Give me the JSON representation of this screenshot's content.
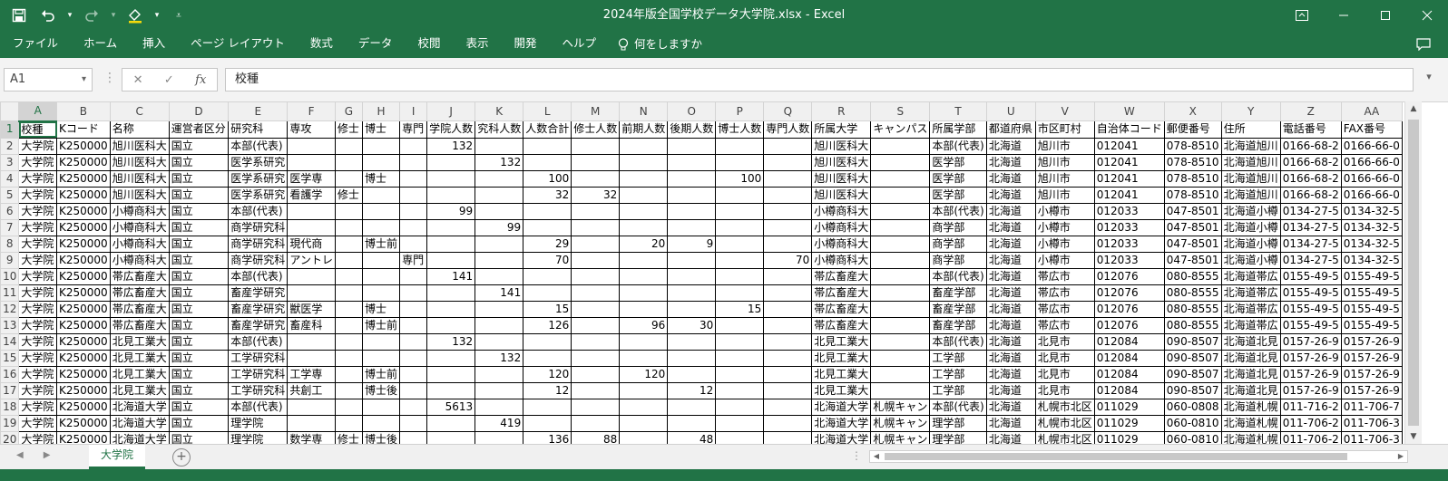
{
  "titlebar": {
    "title": "2024年版全国学校データ大学院.xlsx  -  Excel",
    "qat_icons": [
      "save-icon",
      "undo-icon",
      "redo-icon",
      "paint-brush-icon",
      "customize-qat-icon"
    ],
    "window_controls": [
      "ribbon-display-icon",
      "minimize-icon",
      "restore-icon",
      "close-icon"
    ]
  },
  "ribbon": {
    "tabs": [
      "ファイル",
      "ホーム",
      "挿入",
      "ページ レイアウト",
      "数式",
      "データ",
      "校閲",
      "表示",
      "開発",
      "ヘルプ"
    ],
    "tell_me": "何をしますか"
  },
  "formula_bar": {
    "name_box": "A1",
    "fx_label": "fx",
    "content": "校種"
  },
  "sheet": {
    "columns": [
      {
        "letter": "A",
        "w": 48
      },
      {
        "letter": "B",
        "w": 54
      },
      {
        "letter": "C",
        "w": 66
      },
      {
        "letter": "D",
        "w": 70
      },
      {
        "letter": "E",
        "w": 66
      },
      {
        "letter": "F",
        "w": 44
      },
      {
        "letter": "G",
        "w": 42
      },
      {
        "letter": "H",
        "w": 42
      },
      {
        "letter": "I",
        "w": 42
      },
      {
        "letter": "J",
        "w": 50
      },
      {
        "letter": "K",
        "w": 50
      },
      {
        "letter": "L",
        "w": 50
      },
      {
        "letter": "M",
        "w": 50
      },
      {
        "letter": "N",
        "w": 50
      },
      {
        "letter": "O",
        "w": 50
      },
      {
        "letter": "P",
        "w": 50
      },
      {
        "letter": "Q",
        "w": 50
      },
      {
        "letter": "R",
        "w": 58
      },
      {
        "letter": "S",
        "w": 62
      },
      {
        "letter": "T",
        "w": 64
      },
      {
        "letter": "U",
        "w": 64
      },
      {
        "letter": "V",
        "w": 64
      },
      {
        "letter": "W",
        "w": 76
      },
      {
        "letter": "X",
        "w": 64
      },
      {
        "letter": "Y",
        "w": 64
      },
      {
        "letter": "Z",
        "w": 64
      },
      {
        "letter": "AA",
        "w": 62
      }
    ],
    "numeric_cols": [
      9,
      10,
      11,
      12,
      13,
      14,
      15,
      16
    ],
    "rows": [
      [
        "校種",
        "Kコード",
        "名称",
        "運営者区分",
        "研究科",
        "専攻",
        "修士",
        "博士",
        "専門",
        "学院人数",
        "究科人数",
        "人数合計",
        "修士人数",
        "前期人数",
        "後期人数",
        "博士人数",
        "専門人数",
        "所属大学",
        "キャンパス",
        "所属学部",
        "都道府県",
        "市区町村",
        "自治体コード",
        "郵便番号",
        "住所",
        "電話番号",
        "FAX番号"
      ],
      [
        "大学院",
        "K250000",
        "旭川医科大",
        "国立",
        "本部(代表)",
        "",
        "",
        "",
        "",
        "132",
        "",
        "",
        "",
        "",
        "",
        "",
        "",
        "旭川医科大",
        "",
        "本部(代表)",
        "北海道",
        "旭川市",
        "012041",
        "078-8510",
        "北海道旭川",
        "0166-68-2",
        "0166-66-0"
      ],
      [
        "大学院",
        "K250000",
        "旭川医科大",
        "国立",
        "医学系研究",
        "",
        "",
        "",
        "",
        "",
        "132",
        "",
        "",
        "",
        "",
        "",
        "",
        "旭川医科大",
        "",
        "医学部",
        "北海道",
        "旭川市",
        "012041",
        "078-8510",
        "北海道旭川",
        "0166-68-2",
        "0166-66-0"
      ],
      [
        "大学院",
        "K250000",
        "旭川医科大",
        "国立",
        "医学系研究",
        "医学専",
        "",
        "博士",
        "",
        "",
        "",
        "100",
        "",
        "",
        "",
        "100",
        "",
        "旭川医科大",
        "",
        "医学部",
        "北海道",
        "旭川市",
        "012041",
        "078-8510",
        "北海道旭川",
        "0166-68-2",
        "0166-66-0"
      ],
      [
        "大学院",
        "K250000",
        "旭川医科大",
        "国立",
        "医学系研究",
        "看護学",
        "修士",
        "",
        "",
        "",
        "",
        "32",
        "32",
        "",
        "",
        "",
        "",
        "旭川医科大",
        "",
        "医学部",
        "北海道",
        "旭川市",
        "012041",
        "078-8510",
        "北海道旭川",
        "0166-68-2",
        "0166-66-0"
      ],
      [
        "大学院",
        "K250000",
        "小樽商科大",
        "国立",
        "本部(代表)",
        "",
        "",
        "",
        "",
        "99",
        "",
        "",
        "",
        "",
        "",
        "",
        "",
        "小樽商科大",
        "",
        "本部(代表)",
        "北海道",
        "小樽市",
        "012033",
        "047-8501",
        "北海道小樽",
        "0134-27-5",
        "0134-32-5"
      ],
      [
        "大学院",
        "K250000",
        "小樽商科大",
        "国立",
        "商学研究科",
        "",
        "",
        "",
        "",
        "",
        "99",
        "",
        "",
        "",
        "",
        "",
        "",
        "小樽商科大",
        "",
        "商学部",
        "北海道",
        "小樽市",
        "012033",
        "047-8501",
        "北海道小樽",
        "0134-27-5",
        "0134-32-5"
      ],
      [
        "大学院",
        "K250000",
        "小樽商科大",
        "国立",
        "商学研究科",
        "現代商",
        "",
        "博士前",
        "",
        "",
        "",
        "29",
        "",
        "20",
        "9",
        "",
        "",
        "小樽商科大",
        "",
        "商学部",
        "北海道",
        "小樽市",
        "012033",
        "047-8501",
        "北海道小樽",
        "0134-27-5",
        "0134-32-5"
      ],
      [
        "大学院",
        "K250000",
        "小樽商科大",
        "国立",
        "商学研究科",
        "アントレ",
        "",
        "",
        "専門",
        "",
        "",
        "70",
        "",
        "",
        "",
        "",
        "70",
        "小樽商科大",
        "",
        "商学部",
        "北海道",
        "小樽市",
        "012033",
        "047-8501",
        "北海道小樽",
        "0134-27-5",
        "0134-32-5"
      ],
      [
        "大学院",
        "K250000",
        "帯広畜産大",
        "国立",
        "本部(代表)",
        "",
        "",
        "",
        "",
        "141",
        "",
        "",
        "",
        "",
        "",
        "",
        "",
        "帯広畜産大",
        "",
        "本部(代表)",
        "北海道",
        "帯広市",
        "012076",
        "080-8555",
        "北海道帯広",
        "0155-49-5",
        "0155-49-5"
      ],
      [
        "大学院",
        "K250000",
        "帯広畜産大",
        "国立",
        "畜産学研究",
        "",
        "",
        "",
        "",
        "",
        "141",
        "",
        "",
        "",
        "",
        "",
        "",
        "帯広畜産大",
        "",
        "畜産学部",
        "北海道",
        "帯広市",
        "012076",
        "080-8555",
        "北海道帯広",
        "0155-49-5",
        "0155-49-5"
      ],
      [
        "大学院",
        "K250000",
        "帯広畜産大",
        "国立",
        "畜産学研究",
        "獣医学",
        "",
        "博士",
        "",
        "",
        "",
        "15",
        "",
        "",
        "",
        "15",
        "",
        "帯広畜産大",
        "",
        "畜産学部",
        "北海道",
        "帯広市",
        "012076",
        "080-8555",
        "北海道帯広",
        "0155-49-5",
        "0155-49-5"
      ],
      [
        "大学院",
        "K250000",
        "帯広畜産大",
        "国立",
        "畜産学研究",
        "畜産科",
        "",
        "博士前",
        "",
        "",
        "",
        "126",
        "",
        "96",
        "30",
        "",
        "",
        "帯広畜産大",
        "",
        "畜産学部",
        "北海道",
        "帯広市",
        "012076",
        "080-8555",
        "北海道帯広",
        "0155-49-5",
        "0155-49-5"
      ],
      [
        "大学院",
        "K250000",
        "北見工業大",
        "国立",
        "本部(代表)",
        "",
        "",
        "",
        "",
        "132",
        "",
        "",
        "",
        "",
        "",
        "",
        "",
        "北見工業大",
        "",
        "本部(代表)",
        "北海道",
        "北見市",
        "012084",
        "090-8507",
        "北海道北見",
        "0157-26-9",
        "0157-26-9"
      ],
      [
        "大学院",
        "K250000",
        "北見工業大",
        "国立",
        "工学研究科",
        "",
        "",
        "",
        "",
        "",
        "132",
        "",
        "",
        "",
        "",
        "",
        "",
        "北見工業大",
        "",
        "工学部",
        "北海道",
        "北見市",
        "012084",
        "090-8507",
        "北海道北見",
        "0157-26-9",
        "0157-26-9"
      ],
      [
        "大学院",
        "K250000",
        "北見工業大",
        "国立",
        "工学研究科",
        "工学専",
        "",
        "博士前",
        "",
        "",
        "",
        "120",
        "",
        "120",
        "",
        "",
        "",
        "北見工業大",
        "",
        "工学部",
        "北海道",
        "北見市",
        "012084",
        "090-8507",
        "北海道北見",
        "0157-26-9",
        "0157-26-9"
      ],
      [
        "大学院",
        "K250000",
        "北見工業大",
        "国立",
        "工学研究科",
        "共創工",
        "",
        "博士後",
        "",
        "",
        "",
        "12",
        "",
        "",
        "12",
        "",
        "",
        "北見工業大",
        "",
        "工学部",
        "北海道",
        "北見市",
        "012084",
        "090-8507",
        "北海道北見",
        "0157-26-9",
        "0157-26-9"
      ],
      [
        "大学院",
        "K250000",
        "北海道大学",
        "国立",
        "本部(代表)",
        "",
        "",
        "",
        "",
        "5613",
        "",
        "",
        "",
        "",
        "",
        "",
        "",
        "北海道大学",
        "札幌キャン",
        "本部(代表)",
        "北海道",
        "札幌市北区",
        "011029",
        "060-0808",
        "北海道札幌",
        "011-716-2",
        "011-706-7"
      ],
      [
        "大学院",
        "K250000",
        "北海道大学",
        "国立",
        "理学院",
        "",
        "",
        "",
        "",
        "",
        "419",
        "",
        "",
        "",
        "",
        "",
        "",
        "北海道大学",
        "札幌キャン",
        "理学部",
        "北海道",
        "札幌市北区",
        "011029",
        "060-0810",
        "北海道札幌",
        "011-706-2",
        "011-706-3"
      ],
      [
        "大学院",
        "K250000",
        "北海道大学",
        "国立",
        "理学院",
        "数学専",
        "修士",
        "博士後",
        "",
        "",
        "",
        "136",
        "88",
        "",
        "48",
        "",
        "",
        "北海道大学",
        "札幌キャン",
        "理学部",
        "北海道",
        "札幌市北区",
        "011029",
        "060-0810",
        "北海道札幌",
        "011-706-2",
        "011-706-3"
      ]
    ]
  },
  "sheet_tabs": {
    "active": "大学院"
  }
}
